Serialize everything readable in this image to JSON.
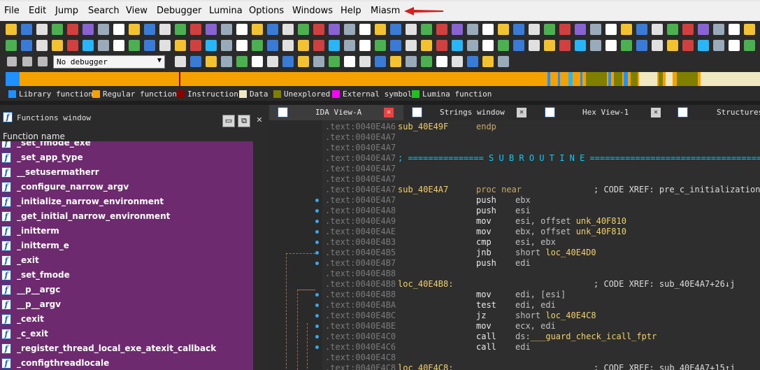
{
  "menu": {
    "items": [
      "File",
      "Edit",
      "Jump",
      "Search",
      "View",
      "Debugger",
      "Lumina",
      "Options",
      "Windows",
      "Help",
      "Miasm"
    ]
  },
  "debugger": {
    "selected": "No debugger"
  },
  "legend": [
    {
      "label": "Library function",
      "color": "#1e90ff"
    },
    {
      "label": "Regular function",
      "color": "#f5a200"
    },
    {
      "label": "Instruction",
      "color": "#8b0000"
    },
    {
      "label": "Data",
      "color": "#f0e8c0"
    },
    {
      "label": "Unexplored",
      "color": "#808000"
    },
    {
      "label": "External symbol",
      "color": "#ff00ff"
    },
    {
      "label": "Lumina function",
      "color": "#20c020"
    }
  ],
  "functions_window": {
    "title": "Functions window",
    "column": "Function name",
    "items": [
      "_set_fmode_exe",
      "_set_app_type",
      "__setusermatherr",
      "_configure_narrow_argv",
      "_initialize_narrow_environment",
      "_get_initial_narrow_environment",
      "_initterm",
      "_initterm_e",
      "_exit",
      "_set_fmode",
      "__p__argc",
      "__p__argv",
      "_cexit",
      "_c_exit",
      "_register_thread_local_exe_atexit_callback",
      "_configthreadlocale"
    ]
  },
  "tabs": [
    {
      "label": "IDA View-A",
      "active": true
    },
    {
      "label": "Strings window",
      "active": false
    },
    {
      "label": "Hex View-1",
      "active": false
    },
    {
      "label": "Structures",
      "active": false
    }
  ],
  "disasm": [
    {
      "addr": ".text:0040E4A6",
      "label": "sub_40E49F",
      "mnem": "endp",
      "ops": "",
      "comment": ""
    },
    {
      "addr": ".text:0040E4A7",
      "label": "",
      "mnem": "",
      "ops": "",
      "comment": ""
    },
    {
      "addr": ".text:0040E4A7",
      "label": "",
      "mnem": "",
      "ops": "",
      "comment": ""
    },
    {
      "addr": ".text:0040E4A7",
      "sep": "; =============== S U B R O U T I N E ======================================="
    },
    {
      "addr": ".text:0040E4A7",
      "label": "",
      "mnem": "",
      "ops": "",
      "comment": ""
    },
    {
      "addr": ".text:0040E4A7",
      "label": "",
      "mnem": "",
      "ops": "",
      "comment": ""
    },
    {
      "addr": ".text:0040E4A7",
      "label": "sub_40E4A7",
      "mnem": "proc near",
      "ops": "",
      "comment": "; CODE XREF: pre_c_initialization("
    },
    {
      "addr": ".text:0040E4A7",
      "label": "",
      "mnem": "push",
      "ops": "ebx",
      "comment": ""
    },
    {
      "addr": ".text:0040E4A8",
      "label": "",
      "mnem": "push",
      "ops": "esi",
      "comment": ""
    },
    {
      "addr": ".text:0040E4A9",
      "label": "",
      "mnem": "mov",
      "ops": "esi, offset unk_40F810",
      "comment": ""
    },
    {
      "addr": ".text:0040E4AE",
      "label": "",
      "mnem": "mov",
      "ops": "ebx, offset unk_40F810",
      "comment": ""
    },
    {
      "addr": ".text:0040E4B3",
      "label": "",
      "mnem": "cmp",
      "ops": "esi, ebx",
      "comment": ""
    },
    {
      "addr": ".text:0040E4B5",
      "label": "",
      "mnem": "jnb",
      "ops": "short loc_40E4D0",
      "comment": ""
    },
    {
      "addr": ".text:0040E4B7",
      "label": "",
      "mnem": "push",
      "ops": "edi",
      "comment": ""
    },
    {
      "addr": ".text:0040E4B8",
      "label": "",
      "mnem": "",
      "ops": "",
      "comment": ""
    },
    {
      "addr": ".text:0040E4B8",
      "label": "loc_40E4B8:",
      "mnem": "",
      "ops": "",
      "comment": "; CODE XREF: sub_40E4A7+26↓j"
    },
    {
      "addr": ".text:0040E4B8",
      "label": "",
      "mnem": "mov",
      "ops": "edi, [esi]",
      "comment": ""
    },
    {
      "addr": ".text:0040E4BA",
      "label": "",
      "mnem": "test",
      "ops": "edi, edi",
      "comment": ""
    },
    {
      "addr": ".text:0040E4BC",
      "label": "",
      "mnem": "jz",
      "ops": "short loc_40E4C8",
      "comment": ""
    },
    {
      "addr": ".text:0040E4BE",
      "label": "",
      "mnem": "mov",
      "ops": "ecx, edi",
      "comment": ""
    },
    {
      "addr": ".text:0040E4C0",
      "label": "",
      "mnem": "call",
      "ops": "ds:___guard_check_icall_fptr",
      "comment": ""
    },
    {
      "addr": ".text:0040E4C6",
      "label": "",
      "mnem": "call",
      "ops": "edi",
      "comment": ""
    },
    {
      "addr": ".text:0040E4C8",
      "label": "",
      "mnem": "",
      "ops": "",
      "comment": ""
    },
    {
      "addr": ".text:0040E4C8",
      "label": "loc_40E4C8:",
      "mnem": "",
      "ops": "",
      "comment": "; CODE XREF: sub_40E4A7+15↑j"
    }
  ]
}
